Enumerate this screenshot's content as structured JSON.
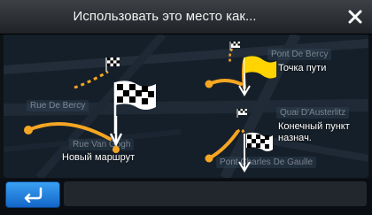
{
  "dialog": {
    "title": "Использовать это место как...",
    "close_icon": "close-icon"
  },
  "options": {
    "new_route": {
      "label": "Новый маршрут",
      "icon": "checkered-flag-icon"
    },
    "waypoint": {
      "label": "Точка пути",
      "icon": "yellow-flag-icon"
    },
    "destination": {
      "label_line1": "Конечный пункт",
      "label_line2": "назнач.",
      "icon": "checkered-flag-icon"
    }
  },
  "map": {
    "streets": [
      "Pont De Bercy",
      "Rue De Bercy",
      "Quai D'Austerlitz",
      "Rue Van Gogh",
      "Pont Charles De Gaulle"
    ]
  },
  "footer": {
    "back_icon": "back-arrow-icon"
  },
  "colors": {
    "route": "#f5a623",
    "back_button": "#1f7fe0",
    "flag_yellow": "#ffd400"
  }
}
